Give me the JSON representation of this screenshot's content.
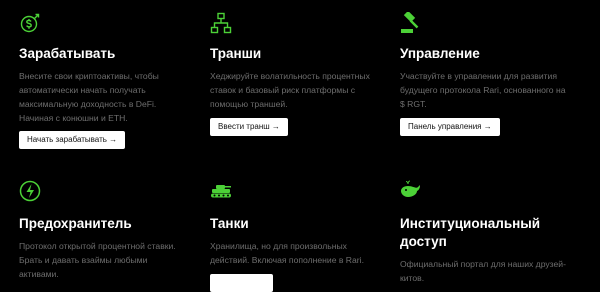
{
  "accent_color": "#4cd137",
  "cards": [
    {
      "icon": "dollar-circle-icon",
      "title": "Зарабатывать",
      "desc": "Внесите свои криптоактивы, чтобы автоматически начать получать максимальную доходность в DeFi. Начиная с конюшни и ETH.",
      "button": "Начать зарабатывать →"
    },
    {
      "icon": "hierarchy-icon",
      "title": "Транши",
      "desc": "Хеджируйте волатильность процентных ставок и базовый риск платформы с помощью траншей.",
      "button": "Ввести транш →"
    },
    {
      "icon": "gavel-icon",
      "title": "Управление",
      "desc": "Участвуйте в управлении для развития будущего протокола Rari, основанного на $ RGT.",
      "button": "Панель управления →"
    },
    {
      "icon": "lightning-icon",
      "title": "Предохранитель",
      "desc": "Протокол открытой процентной ставки. Брать и давать взаймы любыми активами."
    },
    {
      "icon": "tank-icon",
      "title": "Танки",
      "desc": "Хранилища, но для произвольных действий. Включая пополнение в Rari.",
      "button": ""
    },
    {
      "icon": "whale-icon",
      "title": "Институциональный доступ",
      "desc": "Официальный портал для наших друзей-китов."
    }
  ]
}
